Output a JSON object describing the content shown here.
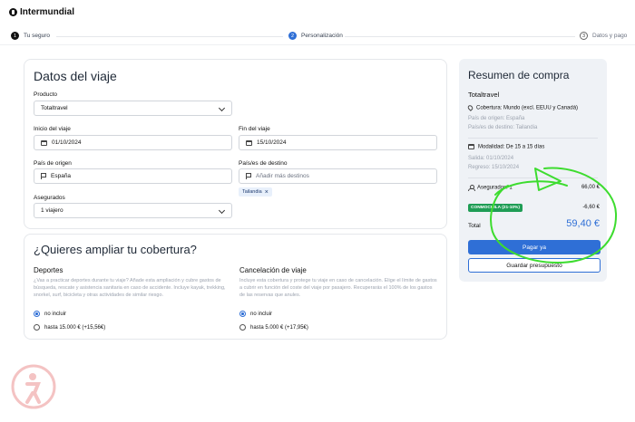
{
  "brand": {
    "name": "Intermundial"
  },
  "steps": [
    {
      "num": "1",
      "label": "Tu seguro"
    },
    {
      "num": "2",
      "label": "Personalización"
    },
    {
      "num": "3",
      "label": "Datos y pago"
    }
  ],
  "trip": {
    "title": "Datos del viaje",
    "product_label": "Producto",
    "product_value": "Totaltravel",
    "start_label": "Inicio del viaje",
    "start_value": "01/10/2024",
    "end_label": "Fin del viaje",
    "end_value": "15/10/2024",
    "origin_label": "País de origen",
    "origin_value": "España",
    "dest_label": "País/es de destino",
    "dest_placeholder": "Añadir más destinos",
    "dest_chip": "Tailandia",
    "insured_label": "Asegurados",
    "insured_value": "1  viajero"
  },
  "coverage": {
    "title": "¿Quieres ampliar tu cobertura?",
    "sports": {
      "title": "Deportes",
      "desc": "¿Vas a practicar deportes durante tu viaje? Añade esta ampliación y cubre gastos de búsqueda, rescate y asistencia sanitaria en caso de accidente. Incluye kayak, trekking, snorkel, surf, bicicleta y otras actividades de similar riesgo.",
      "opt1": "no incluir",
      "opt2": "hasta 15.000 € (+15,56€)"
    },
    "cancel": {
      "title": "Cancelación de viaje",
      "desc": "Incluye esta cobertura y protege tu viaje en caso de cancelación. Elige el límite de gastos a cubrir en función del coste del viaje por pasajero. Recuperarás el 100% de los gastos de las reservas que anules.",
      "opt1": "no incluir",
      "opt2": "hasta 5.000 € (+17,95€)"
    }
  },
  "summary": {
    "title": "Resumen de compra",
    "product": "Totaltravel",
    "coverage": "Cobertura:  Mundo (excl. EEUU y Canadá)",
    "origin": "País de origen: España",
    "destination": "País/es de destino: Tailandia",
    "modality": "Modalidad:  De 15 a 15 días",
    "departure": "Salida: 01/10/2024",
    "return": "Regreso: 15/10/2024",
    "insured": "Asegurados: 1",
    "insured_price": "66,00 €",
    "promo": "CONMOCHILA (21-10%)",
    "discount": "-6,60 €",
    "total_label": "Total",
    "total_value": "59,40 €",
    "pay_button": "Pagar ya",
    "save_button": "Guardar presupuesto"
  },
  "colors": {
    "accent": "#2f6fd6",
    "promo": "#1f9d55",
    "annotation": "#3ddc2f"
  }
}
